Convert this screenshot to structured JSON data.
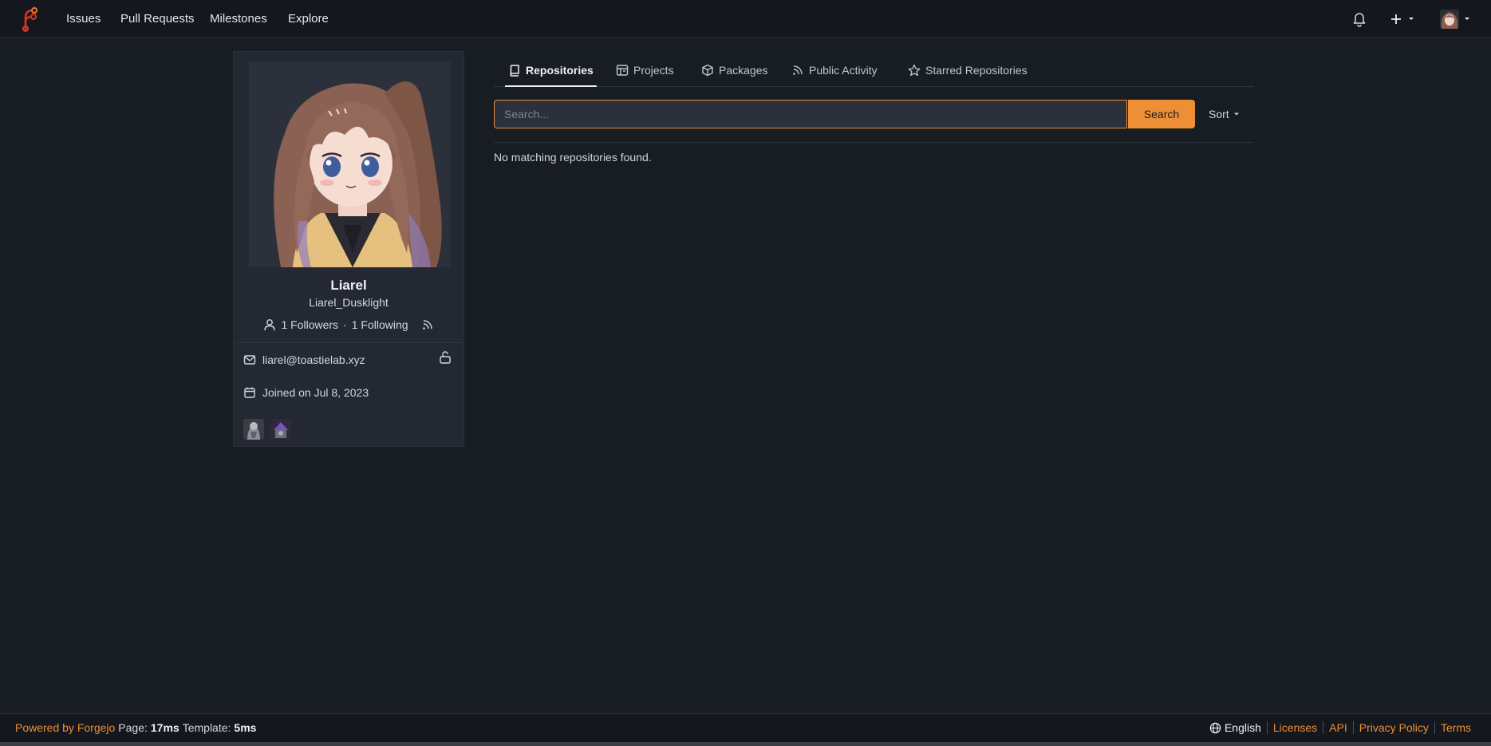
{
  "nav": {
    "logo": "forgejo-logo-icon",
    "links": [
      "Issues",
      "Pull Requests",
      "Milestones",
      "Explore"
    ],
    "right_icons": [
      "bell-icon",
      "plus-icon",
      "user-avatar"
    ]
  },
  "profile": {
    "display_name": "Liarel",
    "username": "Liarel_Dusklight",
    "followers": "1 Followers",
    "separator": "·",
    "following": "1 Following",
    "email": "liarel@toastielab.xyz",
    "joined": "Joined on Jul 8, 2023"
  },
  "tabs": [
    {
      "label": "Repositories",
      "icon": "repo-icon",
      "active": true
    },
    {
      "label": "Projects",
      "icon": "project-icon"
    },
    {
      "label": "Packages",
      "icon": "package-icon"
    },
    {
      "label": "Public Activity",
      "icon": "rss-icon"
    },
    {
      "label": "Starred Repositories",
      "icon": "star-icon"
    }
  ],
  "search": {
    "placeholder": "Search...",
    "button_label": "Search",
    "sort_label": "Sort"
  },
  "content": {
    "empty_message": "No matching repositories found."
  },
  "footer": {
    "powered_by": "Powered by Forgejo",
    "page_label": "Page:",
    "page_time": "17ms",
    "template_label": "Template:",
    "template_time": "5ms",
    "language": "English",
    "links": [
      "Licenses",
      "API",
      "Privacy Policy",
      "Terms"
    ]
  },
  "colors": {
    "accent": "#ee8f36",
    "background": "#181c23",
    "navbar": "#14171d",
    "card": "#232832"
  }
}
